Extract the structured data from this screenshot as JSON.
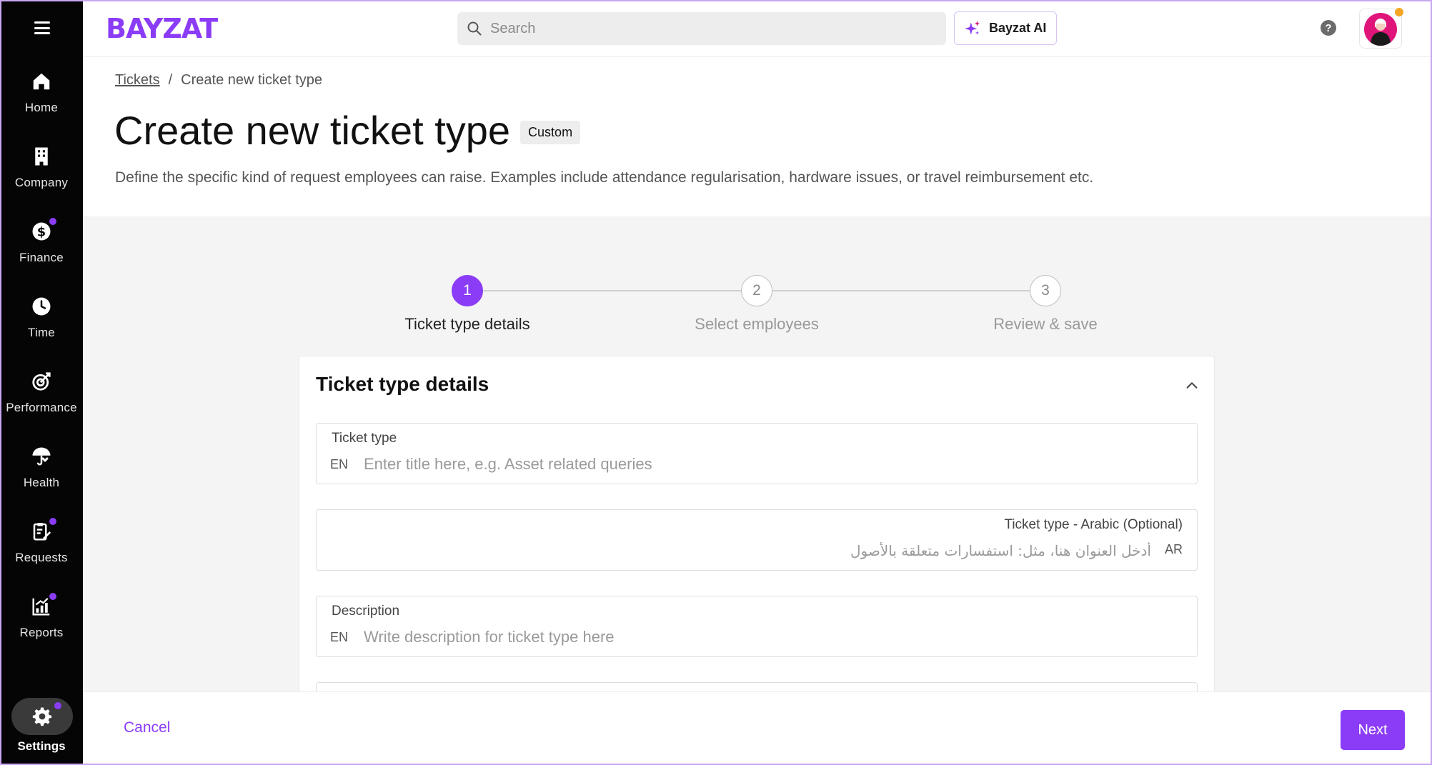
{
  "colors": {
    "accent": "#8b3cf7",
    "sidebar_bg": "#050505",
    "notification_dot": "#8b3cf7",
    "avatar_bg": "#e0157a",
    "avatar_status": "#f5a623"
  },
  "sidebar": {
    "menu_icon": "hamburger-icon",
    "items": [
      {
        "label": "Home",
        "icon": "home-icon",
        "dot": false
      },
      {
        "label": "Company",
        "icon": "building-icon",
        "dot": false
      },
      {
        "label": "Finance",
        "icon": "dollar-coin-icon",
        "dot": true
      },
      {
        "label": "Time",
        "icon": "clock-icon",
        "dot": false
      },
      {
        "label": "Performance",
        "icon": "target-icon",
        "dot": false
      },
      {
        "label": "Health",
        "icon": "umbrella-heart-icon",
        "dot": false
      },
      {
        "label": "Requests",
        "icon": "clipboard-edit-icon",
        "dot": true
      },
      {
        "label": "Reports",
        "icon": "bar-chart-icon",
        "dot": true
      }
    ],
    "settings": {
      "label": "Settings",
      "icon": "gear-icon",
      "dot": true,
      "active": true
    }
  },
  "topbar": {
    "logo": "BAYZAT",
    "search_placeholder": "Search",
    "ai_button": "Bayzat AI",
    "help": "?"
  },
  "header": {
    "breadcrumb": {
      "parent": "Tickets",
      "separator": "/",
      "current": "Create new ticket type"
    },
    "title": "Create new ticket type",
    "badge": "Custom",
    "subtitle": "Define the specific kind of request employees can raise. Examples include attendance regularisation, hardware issues, or travel reimbursement etc."
  },
  "stepper": {
    "steps": [
      {
        "number": "1",
        "label": "Ticket type details",
        "active": true
      },
      {
        "number": "2",
        "label": "Select employees",
        "active": false
      },
      {
        "number": "3",
        "label": "Review & save",
        "active": false
      }
    ]
  },
  "card": {
    "title": "Ticket type details",
    "fields": [
      {
        "label": "Ticket type",
        "lang": "EN",
        "placeholder": "Enter title here, e.g. Asset related queries",
        "value": ""
      },
      {
        "label": "Ticket type - Arabic (Optional)",
        "lang": "AR",
        "placeholder": "أدخل العنوان هنا، مثل: استفسارات متعلقة بالأصول",
        "value": ""
      },
      {
        "label": "Description",
        "lang": "EN",
        "placeholder": "Write description for ticket type here",
        "value": ""
      }
    ]
  },
  "footer": {
    "cancel": "Cancel",
    "next": "Next"
  }
}
